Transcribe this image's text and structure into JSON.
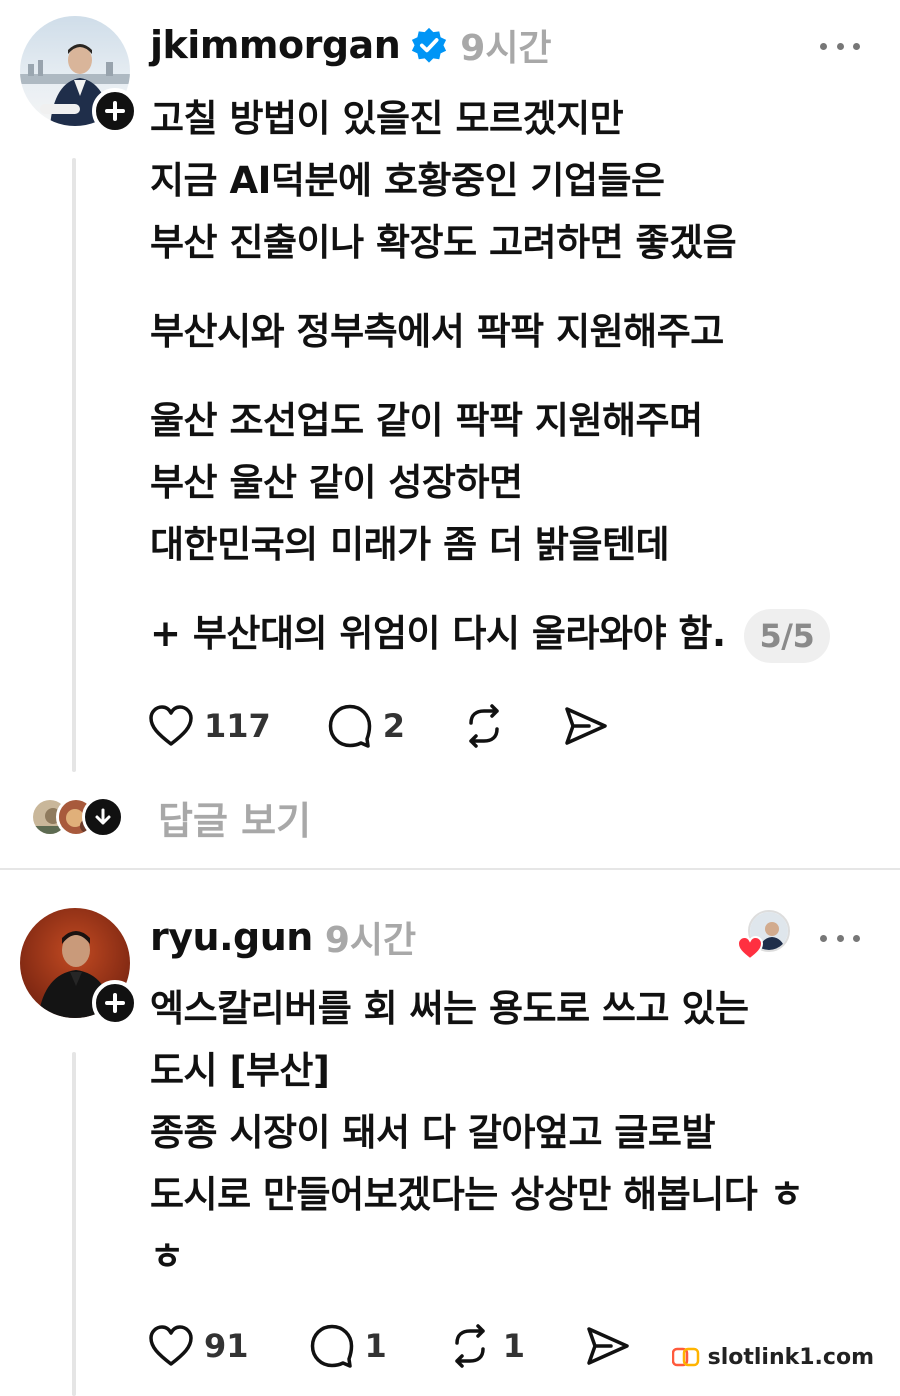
{
  "posts": [
    {
      "username": "jkimmorgan",
      "verified": true,
      "time": "9시간",
      "paragraphs": [
        [
          "고칠 방법이 있을진 모르겠지만",
          "지금 AI덕분에 호황중인 기업들은",
          "부산 진출이나 확장도 고려하면 좋겠음"
        ],
        [
          "부산시와 정부측에서 팍팍 지원해주고"
        ],
        [
          "울산 조선업도 같이 팍팍 지원해주며",
          "부산 울산 같이 성장하면",
          "대한민국의 미래가 좀 더 밝을텐데"
        ]
      ],
      "last_line": "+ 부산대의 위엄이 다시 올라와야 함.",
      "page_indicator": "5/5",
      "likes": "117",
      "comments": "2",
      "reposts": "",
      "view_replies": "답글 보기"
    },
    {
      "username": "ryu.gun",
      "verified": false,
      "time": "9시간",
      "lines": [
        "엑스칼리버를 회 써는 용도로 쓰고 있는",
        "도시 [부산]",
        "종종 시장이 돼서 다 갈아엎고 글로발",
        "도시로 만들어보겠다는 상상만 해봅니다 ㅎ",
        "ㅎ"
      ],
      "likes": "91",
      "comments": "1",
      "reposts": "1"
    }
  ],
  "watermark": "slotlink1.com",
  "colors": {
    "verified": "#0095f6",
    "heart": "#ff3040",
    "muted": "#a8a8a8"
  },
  "icons": [
    "plus-icon",
    "verified-badge-icon",
    "more-icon",
    "heart-icon",
    "comment-icon",
    "repost-icon",
    "share-icon",
    "arrow-down-icon"
  ]
}
